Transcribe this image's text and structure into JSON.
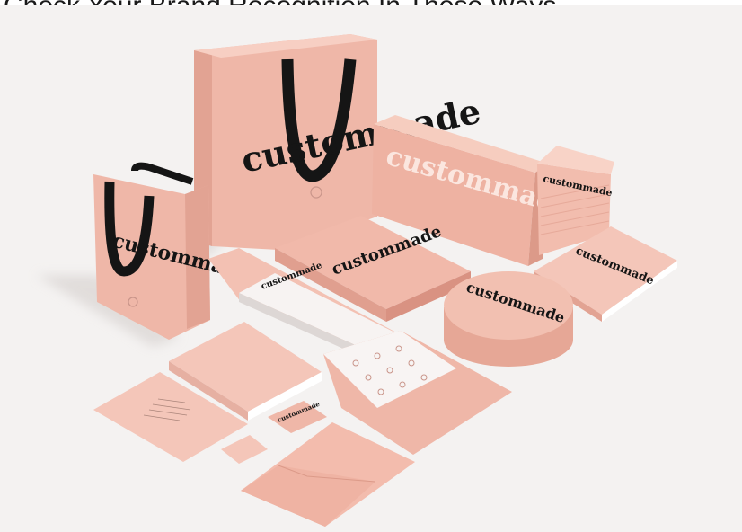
{
  "page": {
    "headline": "Check Your Brand Recognition In These Ways"
  },
  "photo": {
    "subject": "pink branded stationery and packaging set",
    "brand_wordmark": "custommade",
    "colors": {
      "background": "#f4f2f1",
      "pink_light": "#f4c6b9",
      "pink": "#efb7a8",
      "pink_dark": "#e2a393",
      "ink": "#151515",
      "white_card": "#f7f3f2"
    }
  }
}
